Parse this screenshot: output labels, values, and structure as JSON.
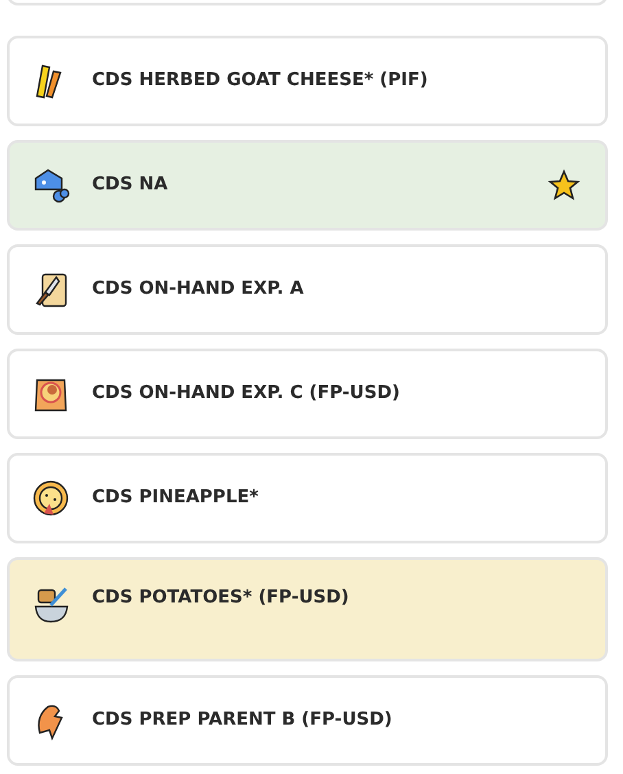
{
  "items": [
    {
      "label": "CDS HERBED GOAT CHEESE* (PIF)",
      "color": "#ffffff",
      "starred": false
    },
    {
      "label": "CDS NA",
      "color": "#e6f0e2",
      "starred": true
    },
    {
      "label": "CDS ON-HAND EXP. A",
      "color": "#ffffff",
      "starred": false
    },
    {
      "label": "CDS ON-HAND EXP. C (FP-USD)",
      "color": "#ffffff",
      "starred": false
    },
    {
      "label": "CDS PINEAPPLE*",
      "color": "#ffffff",
      "starred": false
    },
    {
      "label": "CDS POTATOES* (FP-USD)",
      "color": "#f8efcd",
      "starred": false
    },
    {
      "label": "CDS PREP PARENT B (FP-USD)",
      "color": "#ffffff",
      "starred": false
    }
  ]
}
